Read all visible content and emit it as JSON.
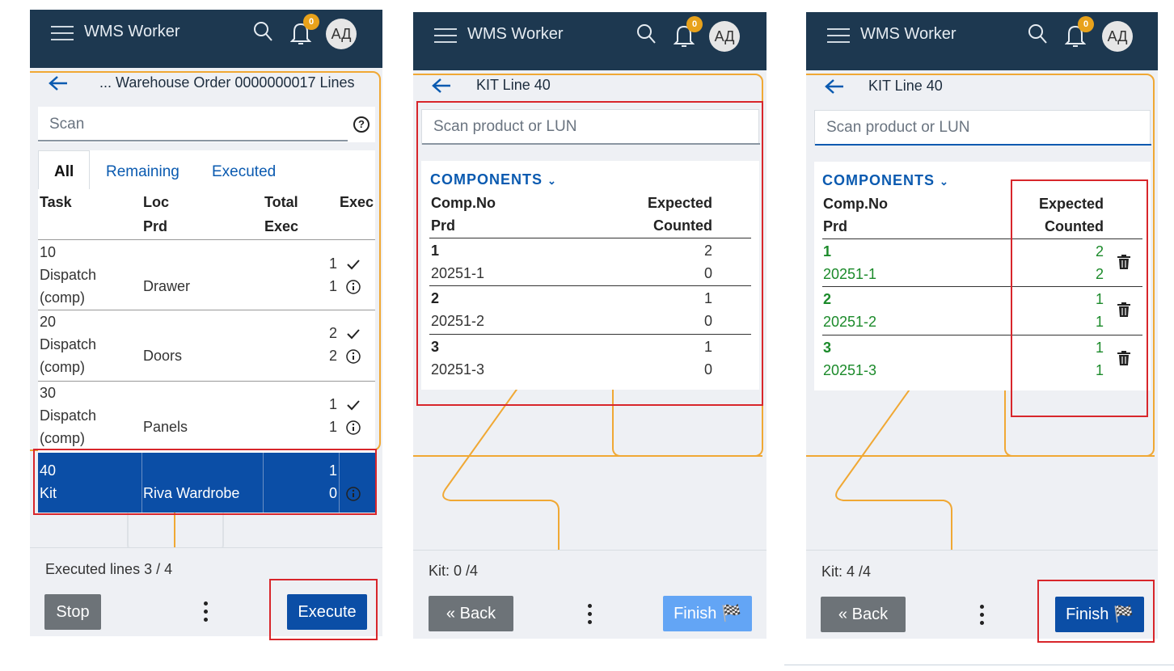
{
  "app_title": "WMS Worker",
  "notif_count": "0",
  "avatar": "АД",
  "screen1": {
    "breadcrumb": "... Warehouse Order 0000000017 Lines",
    "scan_placeholder": "Scan",
    "help": "?",
    "tabs": [
      "All",
      "Remaining",
      "Executed"
    ],
    "headers": {
      "task": "Task",
      "loc": "Loc",
      "prd": "Prd",
      "total": "Total",
      "exec_sub": "Exec",
      "exec": "Exec"
    },
    "rows": [
      {
        "task": "10",
        "type": "Dispatch",
        "type2": "(comp)",
        "prd": "Drawer",
        "total": "1",
        "exec": "1"
      },
      {
        "task": "20",
        "type": "Dispatch",
        "type2": "(comp)",
        "prd": "Doors",
        "total": "2",
        "exec": "2"
      },
      {
        "task": "30",
        "type": "Dispatch",
        "type2": "(comp)",
        "prd": "Panels",
        "total": "1",
        "exec": "1"
      },
      {
        "task": "40",
        "type": "Kit",
        "prd": "Riva Wardrobe",
        "total": "1",
        "exec": "0"
      }
    ],
    "status": "Executed lines 3 / 4",
    "stop": "Stop",
    "execute": "Execute"
  },
  "screen2": {
    "breadcrumb": "KIT Line 40",
    "scan_placeholder": "Scan product or LUN",
    "components_label": "COMPONENTS",
    "headers": {
      "comp": "Comp.No",
      "prd": "Prd",
      "expected": "Expected",
      "counted": "Counted"
    },
    "rows": [
      {
        "comp": "1",
        "prd": "20251-1",
        "expected": "2",
        "counted": "0"
      },
      {
        "comp": "2",
        "prd": "20251-2",
        "expected": "1",
        "counted": "0"
      },
      {
        "comp": "3",
        "prd": "20251-3",
        "expected": "1",
        "counted": "0"
      }
    ],
    "status": "Kit: 0 /4",
    "back": "Back",
    "finish": "Finish"
  },
  "screen3": {
    "breadcrumb": "KIT Line 40",
    "scan_placeholder": "Scan product or LUN",
    "components_label": "COMPONENTS",
    "headers": {
      "comp": "Comp.No",
      "prd": "Prd",
      "expected": "Expected",
      "counted": "Counted"
    },
    "rows": [
      {
        "comp": "1",
        "prd": "20251-1",
        "expected": "2",
        "counted": "2"
      },
      {
        "comp": "2",
        "prd": "20251-2",
        "expected": "1",
        "counted": "1"
      },
      {
        "comp": "3",
        "prd": "20251-3",
        "expected": "1",
        "counted": "1"
      }
    ],
    "status": "Kit: 4 /4",
    "back": "Back",
    "finish": "Finish"
  },
  "colors": {
    "header": "#1d3850",
    "accent": "#0b4ea6",
    "highlight": "#d8262b",
    "guide": "#f0a834",
    "counted": "#1b8a2a"
  }
}
